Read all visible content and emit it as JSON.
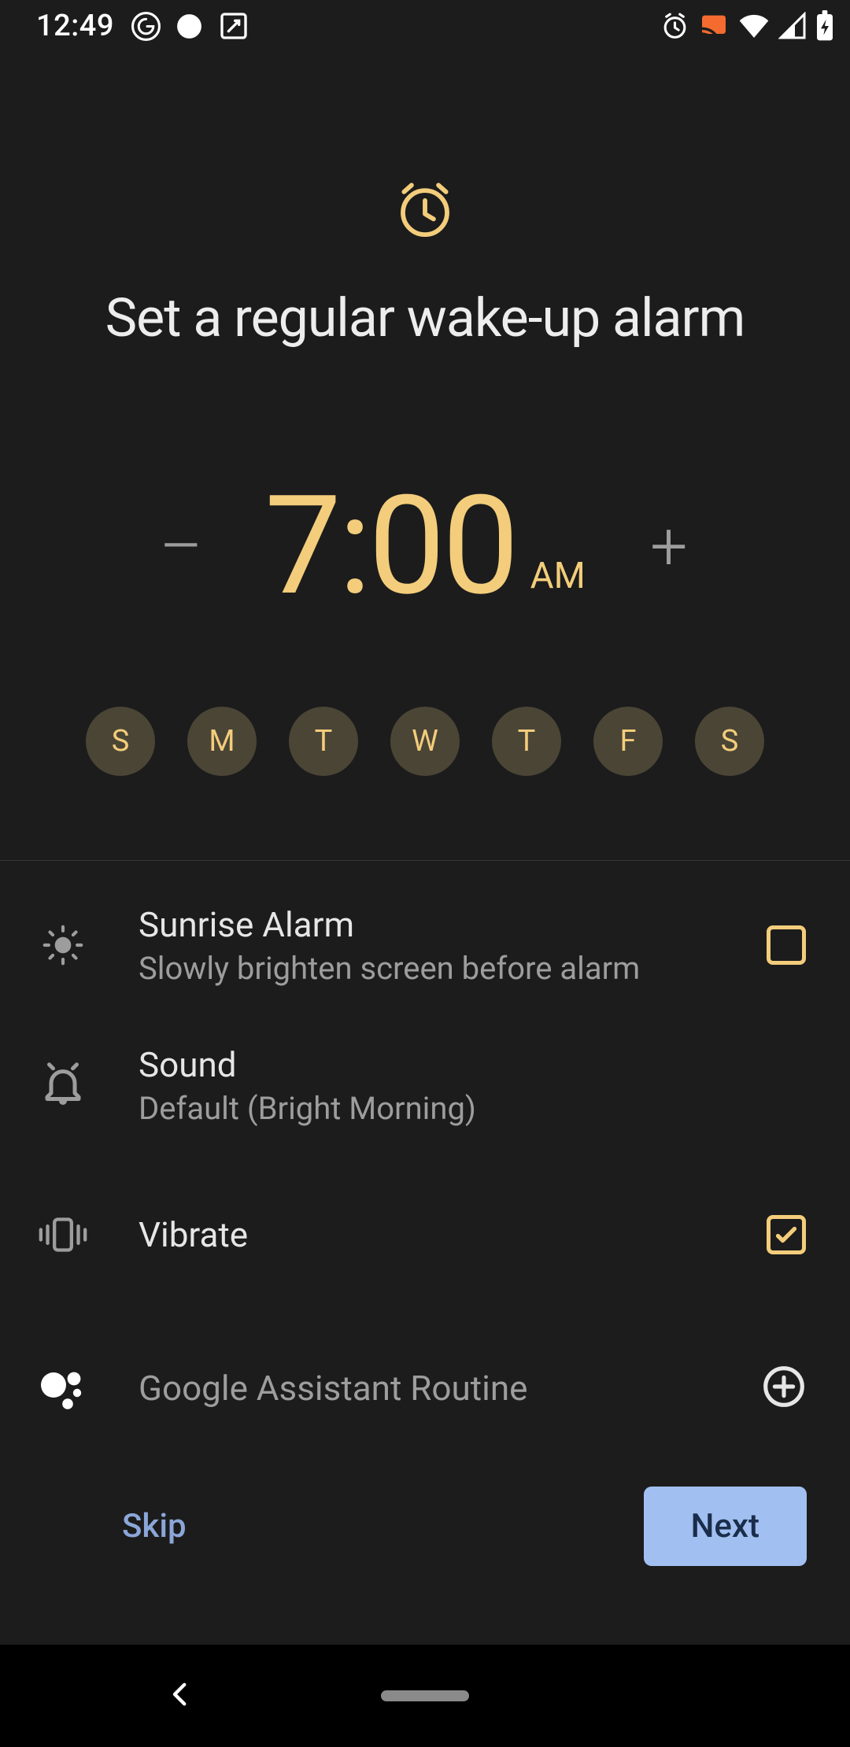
{
  "status": {
    "time": "12:49"
  },
  "header": {
    "title": "Set a regular wake-up alarm"
  },
  "time": {
    "value": "7:00",
    "period": "AM",
    "minus": "–",
    "plus": "+"
  },
  "days": [
    {
      "label": "S"
    },
    {
      "label": "M"
    },
    {
      "label": "T"
    },
    {
      "label": "W"
    },
    {
      "label": "T"
    },
    {
      "label": "F"
    },
    {
      "label": "S"
    }
  ],
  "settings": {
    "sunrise": {
      "title": "Sunrise Alarm",
      "sub": "Slowly brighten screen before alarm",
      "checked": false
    },
    "sound": {
      "title": "Sound",
      "sub": "Default (Bright Morning)"
    },
    "vibrate": {
      "title": "Vibrate",
      "checked": true
    },
    "assistant": {
      "title": "Google Assistant Routine"
    }
  },
  "footer": {
    "skip": "Skip",
    "next": "Next"
  }
}
